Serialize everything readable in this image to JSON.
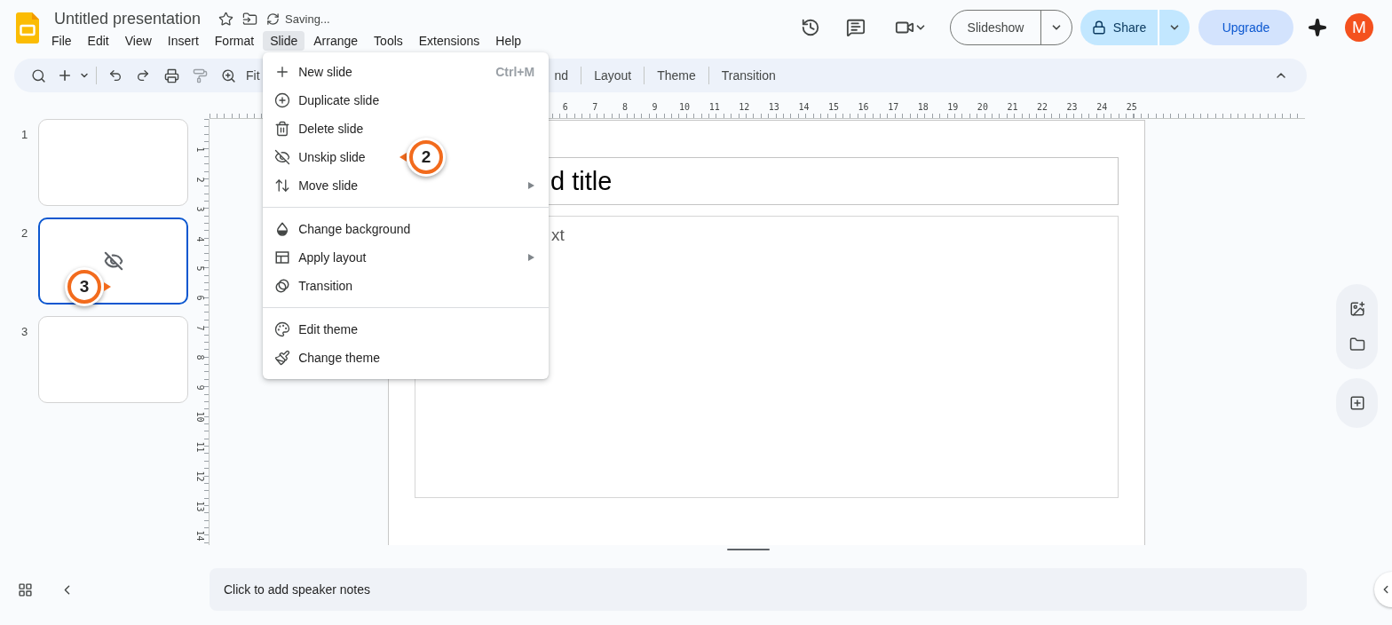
{
  "document": {
    "title": "Untitled presentation",
    "status": "Saving..."
  },
  "menubar": [
    {
      "label": "File",
      "selected": false
    },
    {
      "label": "Edit",
      "selected": false
    },
    {
      "label": "View",
      "selected": false
    },
    {
      "label": "Insert",
      "selected": false
    },
    {
      "label": "Format",
      "selected": false
    },
    {
      "label": "Slide",
      "selected": true
    },
    {
      "label": "Arrange",
      "selected": false
    },
    {
      "label": "Tools",
      "selected": false
    },
    {
      "label": "Extensions",
      "selected": false
    },
    {
      "label": "Help",
      "selected": false
    }
  ],
  "slide_menu": {
    "groups": [
      [
        {
          "label": "New slide",
          "shortcut": "Ctrl+M",
          "submenu": false
        },
        {
          "label": "Duplicate slide",
          "submenu": false
        },
        {
          "label": "Delete slide",
          "submenu": false
        },
        {
          "label": "Unskip slide",
          "submenu": false,
          "callout": {
            "label": "2"
          }
        },
        {
          "label": "Move slide",
          "submenu": true
        }
      ],
      [
        {
          "label": "Change background",
          "submenu": false
        },
        {
          "label": "Apply layout",
          "submenu": true
        },
        {
          "label": "Transition",
          "submenu": false
        }
      ],
      [
        {
          "label": "Edit theme",
          "submenu": false
        },
        {
          "label": "Change theme",
          "submenu": false
        }
      ]
    ]
  },
  "header_actions": {
    "slideshow": "Slideshow",
    "share": "Share",
    "upgrade": "Upgrade",
    "avatar": "M"
  },
  "toolbar": {
    "zoom": "Fit",
    "buttons": [
      "nd",
      "Layout",
      "Theme",
      "Transition"
    ]
  },
  "slides": [
    {
      "number": "1",
      "selected": false,
      "skipped": false
    },
    {
      "number": "2",
      "selected": true,
      "skipped": true,
      "callout": {
        "label": "3"
      }
    },
    {
      "number": "3",
      "selected": false,
      "skipped": false
    }
  ],
  "rulers": {
    "horizontal": [
      "6",
      "7",
      "8",
      "9",
      "10",
      "11",
      "12",
      "13",
      "14",
      "15",
      "16",
      "17",
      "18",
      "19",
      "20",
      "21",
      "22",
      "23",
      "24",
      "25"
    ],
    "vertical": [
      "1",
      "2",
      "3",
      "4",
      "5",
      "6",
      "7",
      "8",
      "9",
      "10",
      "11",
      "12",
      "13",
      "14"
    ]
  },
  "slide": {
    "title": "d title",
    "body": "xt"
  },
  "notes": {
    "placeholder": "Click to add speaker notes"
  }
}
